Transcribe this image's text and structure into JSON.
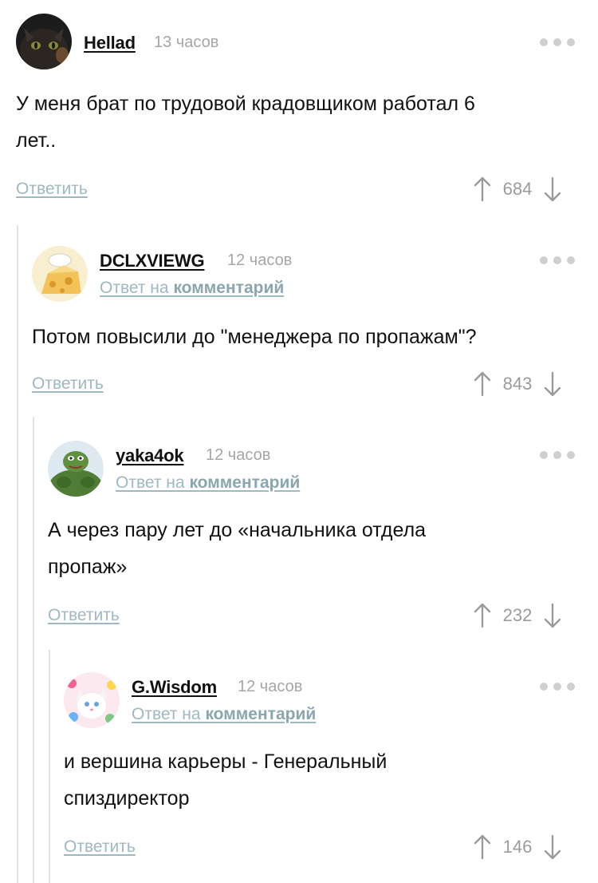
{
  "comments": [
    {
      "author": "Hellad",
      "time": "13 часов",
      "reply_to": null,
      "text_lines": [
        "У меня брат по трудовой крадовщиком работал 6",
        "лет.."
      ],
      "reply_label": "Ответить",
      "score": "684",
      "avatar": "dark-cat-avatar"
    },
    {
      "author": "DCLXVIEWG",
      "time": "12 часов",
      "reply_to": {
        "prefix": "Ответ на",
        "target": "комментарий"
      },
      "text_lines": [
        "Потом повысили до \"менеджера по пропажам\"?"
      ],
      "reply_label": "Ответить",
      "score": "843",
      "avatar": "cheese-chef-avatar"
    },
    {
      "author": "yaka4ok",
      "time": "12 часов",
      "reply_to": {
        "prefix": "Ответ на",
        "target": "комментарий"
      },
      "text_lines": [
        "А через пару лет до «начальника отдела",
        "пропаж»"
      ],
      "reply_label": "Ответить",
      "score": "232",
      "avatar": "green-frog-avatar"
    },
    {
      "author": "G.Wisdom",
      "time": "12 часов",
      "reply_to": {
        "prefix": "Ответ на",
        "target": "комментарий"
      },
      "text_lines": [
        "и вершина карьеры - Генеральный",
        "спиздиректор"
      ],
      "reply_label": "Ответить",
      "score": "146",
      "avatar": "white-kitten-avatar"
    }
  ],
  "colors": {
    "link": "#9fb9c0",
    "muted": "#a6a6a6",
    "thread_line": "#e3e3e3"
  }
}
